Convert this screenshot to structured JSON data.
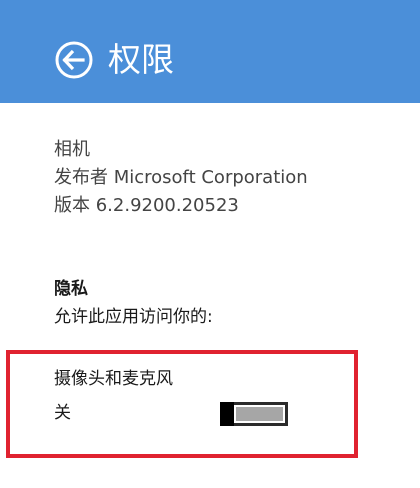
{
  "header": {
    "title": "权限",
    "back_icon": "back-arrow-circle-icon",
    "background_color": "#4b8fd9"
  },
  "app_info": {
    "name": "相机",
    "publisher": "发布者 Microsoft Corporation",
    "version": "版本 6.2.9200.20523"
  },
  "privacy": {
    "title": "隐私",
    "description": "允许此应用访问你的:",
    "permissions": [
      {
        "label": "摄像头和麦克风",
        "state_label": "关",
        "enabled": false
      }
    ]
  },
  "highlight_color": "#e02230"
}
